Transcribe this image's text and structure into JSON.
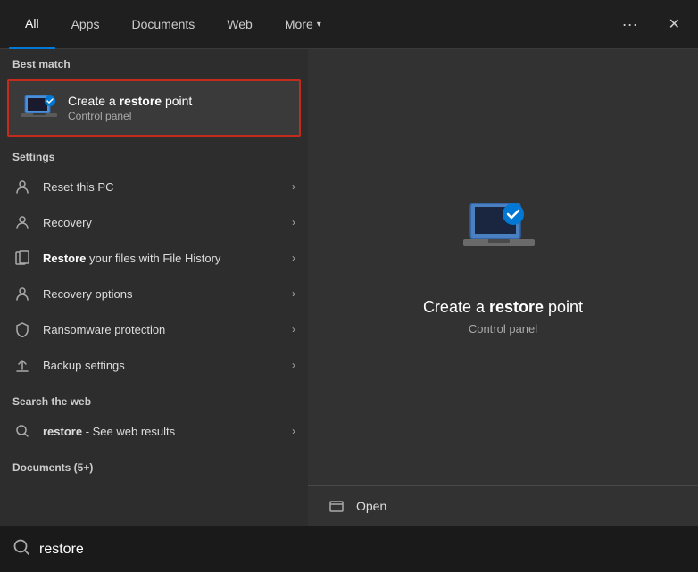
{
  "nav": {
    "tabs": [
      {
        "id": "all",
        "label": "All",
        "active": true
      },
      {
        "id": "apps",
        "label": "Apps"
      },
      {
        "id": "documents",
        "label": "Documents"
      },
      {
        "id": "web",
        "label": "Web"
      },
      {
        "id": "more",
        "label": "More",
        "hasArrow": true
      }
    ]
  },
  "best_match": {
    "section_label": "Best match",
    "item": {
      "title_prefix": "Create a ",
      "title_bold": "restore",
      "title_suffix": " point",
      "subtitle": "Control panel"
    }
  },
  "settings": {
    "section_label": "Settings",
    "items": [
      {
        "id": "reset",
        "label": "Reset this PC",
        "icon": "person"
      },
      {
        "id": "recovery",
        "label": "Recovery",
        "icon": "refresh"
      },
      {
        "id": "restore",
        "label_prefix": "",
        "label_bold": "Restore",
        "label_suffix": " your files with File History",
        "icon": "shield"
      },
      {
        "id": "recovery-options",
        "label": "Recovery options",
        "icon": "person"
      },
      {
        "id": "ransomware",
        "label": "Ransomware protection",
        "icon": "shield"
      },
      {
        "id": "backup",
        "label": "Backup settings",
        "icon": "upload"
      }
    ]
  },
  "web_search": {
    "section_label": "Search the web",
    "item": {
      "label_bold": "restore",
      "label_suffix": " - See web results"
    }
  },
  "documents": {
    "section_label": "Documents (5+)"
  },
  "right_panel": {
    "title_prefix": "Create a ",
    "title_bold": "restore",
    "title_suffix": " point",
    "subtitle": "Control panel",
    "actions": [
      {
        "id": "open",
        "label": "Open"
      }
    ]
  },
  "search_bar": {
    "placeholder": "restore",
    "value": "restore"
  }
}
